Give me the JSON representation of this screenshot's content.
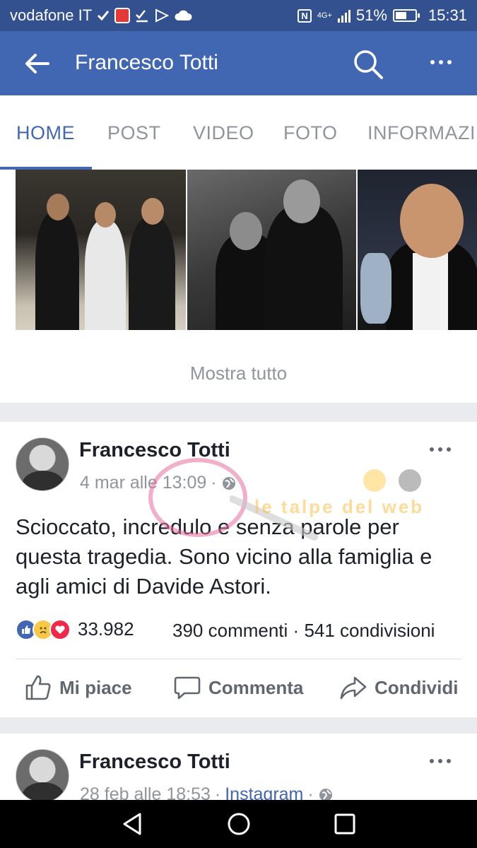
{
  "status_bar": {
    "carrier": "vodafone IT",
    "network": "4G+",
    "battery": "51%",
    "time": "15:31"
  },
  "app_bar": {
    "title": "Francesco Totti",
    "back_icon": "arrow-back-icon",
    "search_icon": "search-icon",
    "more_icon": "more-horizontal-icon"
  },
  "tabs": [
    {
      "label": "HOME",
      "active": true
    },
    {
      "label": "POST",
      "active": false
    },
    {
      "label": "VIDEO",
      "active": false
    },
    {
      "label": "FOTO",
      "active": false
    },
    {
      "label": "INFORMAZI",
      "active": false
    }
  ],
  "photos": {
    "show_all": "Mostra tutto"
  },
  "post1": {
    "author": "Francesco Totti",
    "date": "4 mar alle 13:09",
    "separator": "·",
    "text": "Scioccato, incredulo e senza parole per questa tragedia. Sono vicino alla famiglia e agli amici di Davide Astori.",
    "reaction_count": "33.982",
    "comments": "390 commenti",
    "shares": "541 condivisioni",
    "actions": {
      "like": "Mi piace",
      "comment": "Commenta",
      "share": "Condividi"
    }
  },
  "post2": {
    "author": "Francesco Totti",
    "date": "28 feb alle 18:53",
    "source": "Instagram",
    "separator": "·"
  },
  "watermark": {
    "text": "le talpe del web"
  },
  "colors": {
    "status_bar": "#33508f",
    "app_bar": "#4267b2",
    "accent": "#4267b2",
    "muted_text": "#90949c",
    "background": "#e9ebee"
  }
}
